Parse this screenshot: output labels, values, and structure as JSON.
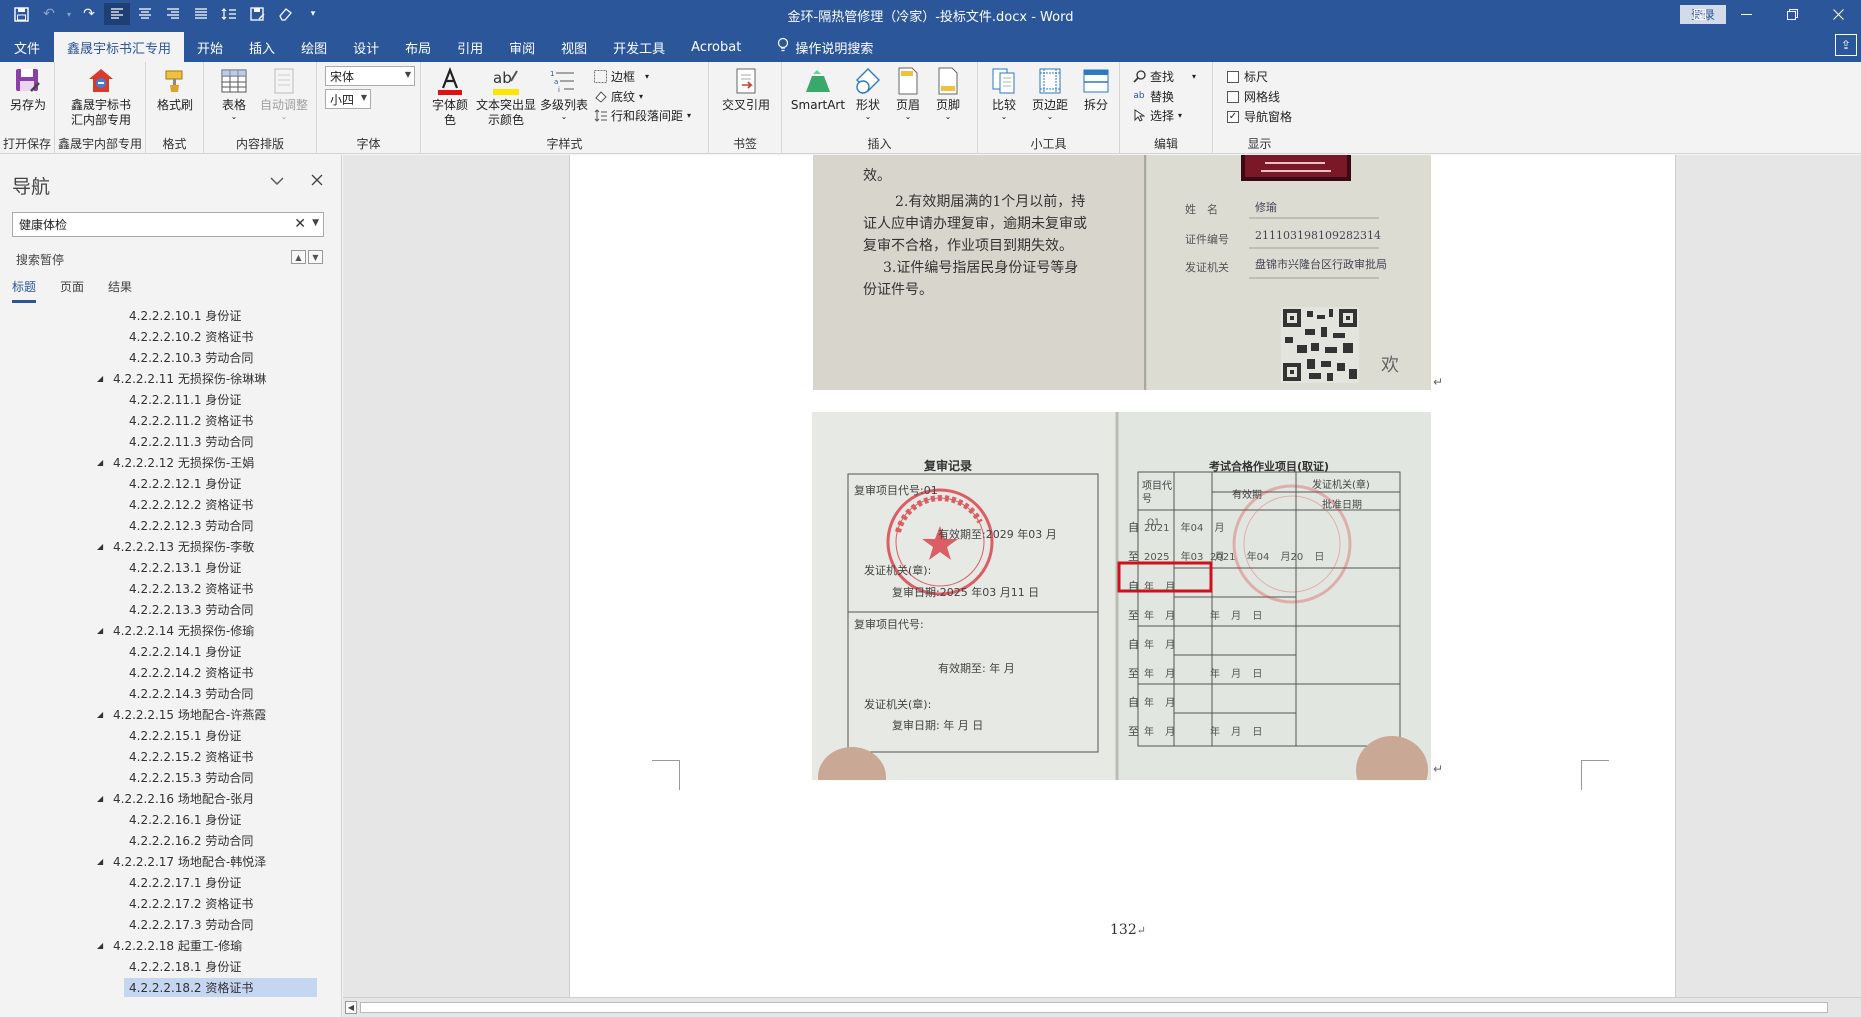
{
  "window": {
    "title": "金环-隔热管修理（冷家）-投标文件.docx - Word",
    "login_label": "登录"
  },
  "tabs": [
    "文件",
    "鑫晟宇标书汇专用",
    "开始",
    "插入",
    "绘图",
    "设计",
    "布局",
    "引用",
    "审阅",
    "视图",
    "开发工具",
    "Acrobat"
  ],
  "tell_me": "操作说明搜索",
  "ribbon": {
    "groups": {
      "open_save": "打开保存",
      "xsy": "鑫晟宇内部专用",
      "format": "格式",
      "content": "内容排版",
      "font": "字体",
      "style": "字样式",
      "bookmark": "书签",
      "insert": "插入",
      "tools": "小工具",
      "edit": "编辑",
      "show": "显示"
    },
    "buttons": {
      "save_as": "另存为",
      "xsy_line1": "鑫晟宇标书",
      "xsy_line2": "汇内部专用",
      "format_painter": "格式刷",
      "table": "表格",
      "auto_adjust": "自动调整",
      "font_color_line1": "字体颜",
      "font_color_line2": "色",
      "highlight_line1": "文本突出显",
      "highlight_line2": "示颜色",
      "multilevel": "多级列表",
      "border": "边框",
      "shading": "底纹",
      "line_spacing": "行和段落间距",
      "cross_ref": "交叉引用",
      "smartart": "SmartArt",
      "shapes": "形状",
      "header": "页眉",
      "footer": "页脚",
      "compare": "比较",
      "margins": "页边距",
      "split": "拆分",
      "find": "查找",
      "replace": "替换",
      "select": "选择",
      "ruler": "标尺",
      "gridlines": "网格线",
      "nav_pane": "导航窗格"
    },
    "font_name": "宋体",
    "font_size": "小四",
    "checkboxes": {
      "ruler": false,
      "gridlines": false,
      "nav_pane": true
    }
  },
  "nav": {
    "title": "导航",
    "search_value": "健康体检",
    "status": "搜索暂停",
    "tabs": [
      "标题",
      "页面",
      "结果"
    ],
    "items": [
      {
        "label": "4.2.2.2.10.1 身份证",
        "level": 4
      },
      {
        "label": "4.2.2.2.10.2 资格证书",
        "level": 4
      },
      {
        "label": "4.2.2.2.10.3 劳动合同",
        "level": 4
      },
      {
        "label": "4.2.2.2.11 无损探伤-徐琳琳",
        "level": 3
      },
      {
        "label": "4.2.2.2.11.1 身份证",
        "level": 4
      },
      {
        "label": "4.2.2.2.11.2 资格证书",
        "level": 4
      },
      {
        "label": "4.2.2.2.11.3 劳动合同",
        "level": 4
      },
      {
        "label": "4.2.2.2.12 无损探伤-王娟",
        "level": 3
      },
      {
        "label": "4.2.2.2.12.1 身份证",
        "level": 4
      },
      {
        "label": "4.2.2.2.12.2 资格证书",
        "level": 4
      },
      {
        "label": "4.2.2.2.12.3 劳动合同",
        "level": 4
      },
      {
        "label": "4.2.2.2.13 无损探伤-李敬",
        "level": 3
      },
      {
        "label": "4.2.2.2.13.1 身份证",
        "level": 4
      },
      {
        "label": "4.2.2.2.13.2 资格证书",
        "level": 4
      },
      {
        "label": "4.2.2.2.13.3 劳动合同",
        "level": 4
      },
      {
        "label": "4.2.2.2.14 无损探伤-修瑜",
        "level": 3
      },
      {
        "label": "4.2.2.2.14.1 身份证",
        "level": 4
      },
      {
        "label": "4.2.2.2.14.2 资格证书",
        "level": 4
      },
      {
        "label": "4.2.2.2.14.3 劳动合同",
        "level": 4
      },
      {
        "label": "4.2.2.2.15 场地配合-许燕霞",
        "level": 3
      },
      {
        "label": "4.2.2.2.15.1 身份证",
        "level": 4
      },
      {
        "label": "4.2.2.2.15.2 资格证书",
        "level": 4
      },
      {
        "label": "4.2.2.2.15.3 劳动合同",
        "level": 4
      },
      {
        "label": "4.2.2.2.16 场地配合-张月",
        "level": 3
      },
      {
        "label": "4.2.2.2.16.1 身份证",
        "level": 4
      },
      {
        "label": "4.2.2.2.16.2 劳动合同",
        "level": 4
      },
      {
        "label": "4.2.2.2.17 场地配合-韩悦泽",
        "level": 3
      },
      {
        "label": "4.2.2.2.17.1 身份证",
        "level": 4
      },
      {
        "label": "4.2.2.2.17.2 资格证书",
        "level": 4
      },
      {
        "label": "4.2.2.2.17.3 劳动合同",
        "level": 4
      },
      {
        "label": "4.2.2.2.18 起重工-修瑜",
        "level": 3
      },
      {
        "label": "4.2.2.2.18.1 身份证",
        "level": 4
      },
      {
        "label": "4.2.2.2.18.2 资格证书",
        "level": 4,
        "selected": true
      }
    ]
  },
  "document": {
    "page_number": "132",
    "para_mark": "↵",
    "photo1": {
      "left_lines": [
        "效。",
        "2.有效期届满的1个月以前，持",
        "证人应申请办理复审，逾期未复审或",
        "复审不合格，作业项目到期失效。",
        "3.证件编号指居民身份证号等身",
        "份证件号。"
      ],
      "name_label": "姓　名",
      "name_value": "修瑜",
      "id_label": "证件编号",
      "id_value": "211103198109282314",
      "issuer_label": "发证机关",
      "issuer_value": "盘锦市兴隆台区行政审批局",
      "signature": "欢"
    },
    "photo2": {
      "left_title": "复审记录",
      "left_entries": [
        "复审项目代号:01",
        "有效期至:2029 年03 月",
        "发证机关(章):",
        "复审日期:2025 年03 月11 日",
        "复审项目代号:",
        "有效期至: 年 月",
        "发证机关(章):",
        "复审日期: 年 月 日"
      ],
      "right_title": "考试合格作业项目(取证)",
      "col_code": "项目代号",
      "col_valid": "有效期",
      "col_issuer": "发证机关(章)",
      "col_approve": "批准日期",
      "code_value": "Q1",
      "rows": [
        {
          "prefix": "自",
          "date": "2021 年04 月"
        },
        {
          "prefix": "至",
          "date": "2025 年03 月",
          "approve": "2021 年04 月20 日",
          "highlight": true
        },
        {
          "prefix": "自",
          "date": "年 月"
        },
        {
          "prefix": "至",
          "date": "年 月",
          "approve": "年 月 日"
        },
        {
          "prefix": "自",
          "date": "年 月"
        },
        {
          "prefix": "至",
          "date": "年 月",
          "approve": "年 月 日"
        },
        {
          "prefix": "自",
          "date": "年 月"
        },
        {
          "prefix": "至",
          "date": "年 月",
          "approve": "年 月 日"
        }
      ]
    }
  },
  "colors": {
    "title_bar": "#2b579a",
    "highlight_box": "#d0101a",
    "font_color_bar": "#e01010",
    "highlight_bar": "#ffe600"
  }
}
